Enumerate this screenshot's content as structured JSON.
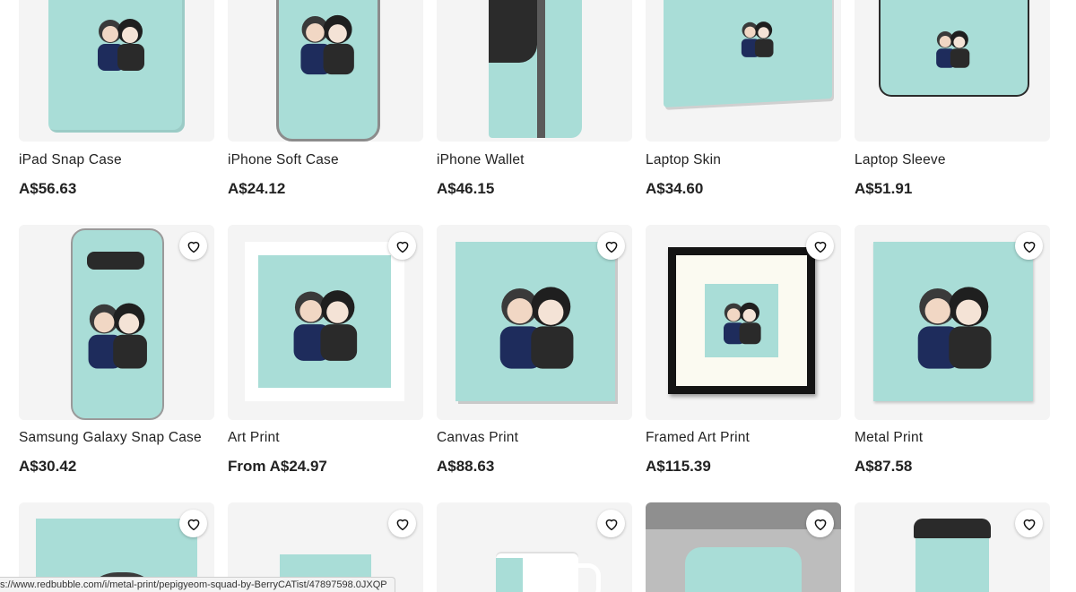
{
  "products": [
    {
      "title": "iPad Snap Case",
      "price": "A$56.63",
      "favorite": false
    },
    {
      "title": "iPhone Soft Case",
      "price": "A$24.12",
      "favorite": false
    },
    {
      "title": "iPhone Wallet",
      "price": "A$46.15",
      "favorite": false
    },
    {
      "title": "Laptop Skin",
      "price": "A$34.60",
      "favorite": false
    },
    {
      "title": "Laptop Sleeve",
      "price": "A$51.91",
      "favorite": false
    },
    {
      "title": "Samsung Galaxy Snap Case",
      "price": "A$30.42",
      "favorite": true
    },
    {
      "title": "Art Print",
      "price": "From A$24.97",
      "favorite": true
    },
    {
      "title": "Canvas Print",
      "price": "A$88.63",
      "favorite": true
    },
    {
      "title": "Framed Art Print",
      "price": "A$115.39",
      "favorite": true
    },
    {
      "title": "Metal Print",
      "price": "A$87.58",
      "favorite": true
    },
    {
      "favorite": true
    },
    {
      "favorite": true
    },
    {
      "favorite": true
    },
    {
      "favorite": true
    },
    {
      "favorite": true
    }
  ],
  "status_bar": {
    "url": "s://www.redbubble.com/i/metal-print/pepigyeom-squad-by-BerryCATist/47897598.0JXQP"
  },
  "colors": {
    "mint": "#a9ddd7",
    "tile_bg": "#f4f4f4",
    "text": "#222222"
  },
  "icons": {
    "favorite": "heart-outline-icon"
  }
}
